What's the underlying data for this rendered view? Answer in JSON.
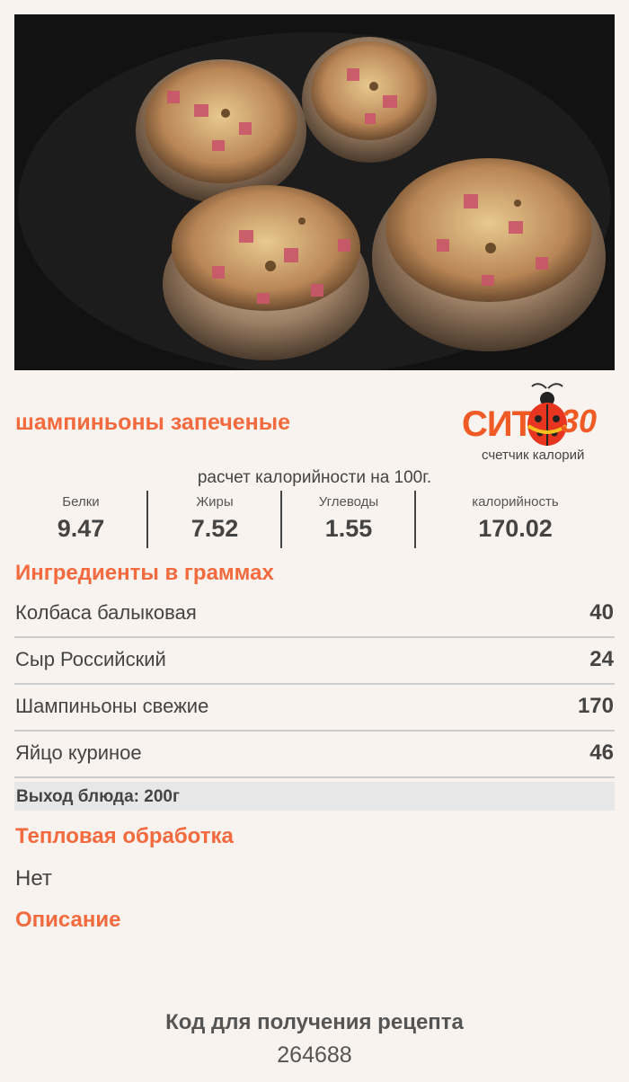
{
  "recipe": {
    "title": "шампиньоны запеченые",
    "photo_alt": "шампиньоны запеченые"
  },
  "logo": {
    "wordmark": "СИТ",
    "number": "30",
    "tagline": "счетчик калорий"
  },
  "nutrition": {
    "note": "расчет калорийности на 100г.",
    "items": [
      {
        "label": "Белки",
        "value": "9.47"
      },
      {
        "label": "Жиры",
        "value": "7.52"
      },
      {
        "label": "Углеводы",
        "value": "1.55"
      },
      {
        "label": "калорийность",
        "value": "170.02"
      }
    ]
  },
  "ingredients": {
    "heading": "Ингредиенты в граммах",
    "rows": [
      {
        "name": "Колбаса балыковая",
        "qty": "40"
      },
      {
        "name": "Сыр Российский",
        "qty": "24"
      },
      {
        "name": "Шампиньоны свежие",
        "qty": "170"
      },
      {
        "name": "Яйцо куриное",
        "qty": "46"
      }
    ],
    "yield": "Выход блюда: 200г"
  },
  "heat": {
    "heading": "Тепловая обработка",
    "value": "Нет"
  },
  "description": {
    "heading": "Описание"
  },
  "code": {
    "heading": "Код для получения рецепта",
    "value": "264688"
  },
  "colors": {
    "accent": "#f26a3d",
    "background": "#f8f3ef"
  }
}
